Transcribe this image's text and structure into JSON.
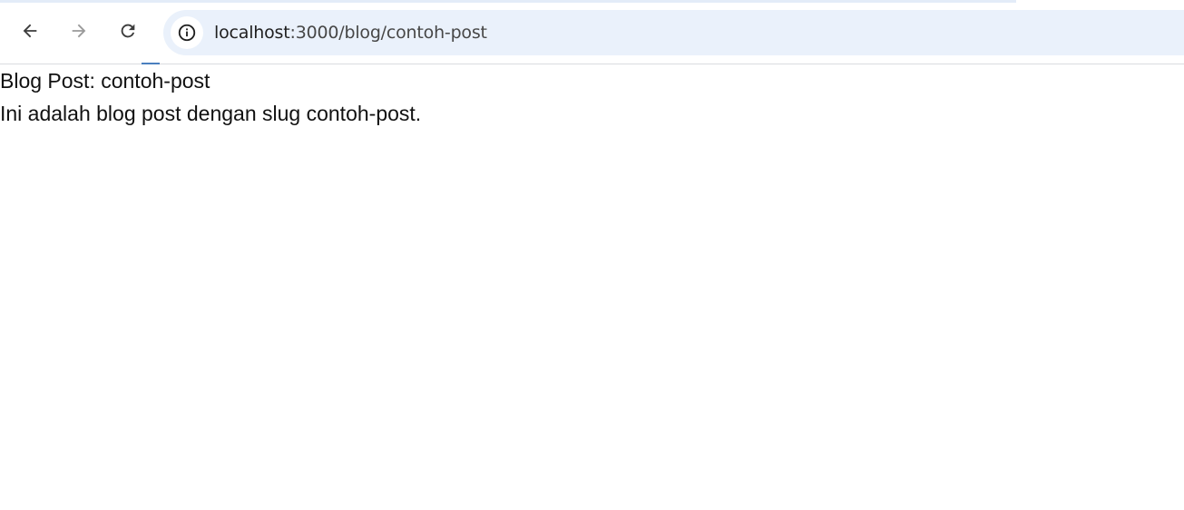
{
  "browser": {
    "url_host": "localhost",
    "url_path": ":3000/blog/contoh-post",
    "icons": {
      "back": "arrow-left-icon",
      "forward": "arrow-right-icon",
      "reload": "reload-icon",
      "site_info": "info-icon"
    }
  },
  "page": {
    "title": "Blog Post: contoh-post",
    "body": "Ini adalah blog post dengan slug contoh-post."
  },
  "colors": {
    "omnibox_bg": "#eaf1fb",
    "text": "#111111"
  }
}
